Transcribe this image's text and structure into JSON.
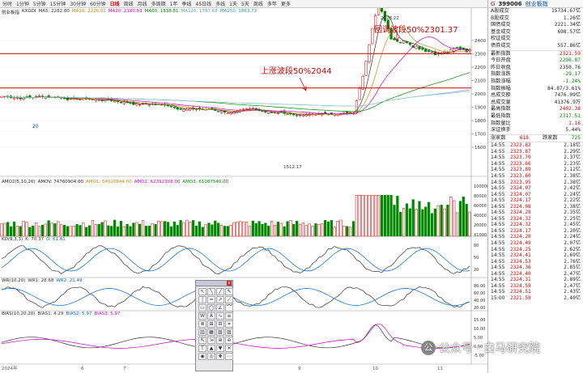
{
  "tabs": [
    "分时",
    "1分钟",
    "5分钟",
    "15分钟",
    "30分钟",
    "60分钟",
    "日线",
    "周线",
    "月线",
    "多周期",
    "1年",
    "季线",
    "45日线",
    "多线",
    "1天",
    "5天",
    "周线",
    "多年",
    "更多"
  ],
  "active_tab": "日线",
  "main_legend": {
    "name": "创业板指",
    "prefix": "KXGDI",
    "ma5": "MA5: 2282.80",
    "ma10": "MA10: 2226.01",
    "ma20": "MA20: 2180.83",
    "ma60": "MA60: 1838.81",
    "ma120": "MA120: 1787.68",
    "ma250": "MA250: 1863.73"
  },
  "annotations": {
    "pullback": "回调波段50%2301.37",
    "rise": "上涨波段50%2044",
    "high": "2578.22",
    "low": "1512.17",
    "marker_20": "20"
  },
  "price_axis": [
    "2400",
    "2300",
    "2200",
    "2100",
    "2000",
    "1900",
    "1800",
    "1700",
    "1600"
  ],
  "date_labels": [
    "2024年",
    "6",
    "7",
    "8",
    "9",
    "10",
    "11"
  ],
  "vol_legend": {
    "name": "AMO2(5,10,20)",
    "amov": "AMOV: 74760904.00",
    "amo1": "AMO1: 64520844.00",
    "amo2": "AMO2: 62392308.00",
    "amo3": "AMO3: 61087540.00"
  },
  "vol_axis": [
    "100000",
    "80000",
    "60000",
    "40000",
    "20000",
    "X1000"
  ],
  "kd_legend": {
    "name": "KD(9,3,3)",
    "k": "K: 70.37",
    "d": "D: 61.81"
  },
  "kd_axis": [
    "80",
    "50",
    "20"
  ],
  "wr_legend": {
    "name": "WR(10,20)",
    "wr1": "WR1: 28.68",
    "wr2": "WR2: 21.49"
  },
  "wr_axis": [
    "80.00",
    "60.00",
    "40.00",
    "20.00"
  ],
  "bias_legend": {
    "name": "BIAS(10,20,20)",
    "b1": "BIAS1: 4.29",
    "b2": "BIAS2: 5.97",
    "b3": "BIAS3: 5.97"
  },
  "bias_axis": [
    "15.00",
    "10.00",
    "5.00",
    "0.00",
    "-5.00"
  ],
  "tools": [
    "↖",
    "╲",
    "╱",
    "✎",
    "│",
    "━",
    "↗",
    "⟋",
    "▭",
    "◯",
    "∠",
    "⌒",
    "W",
    "A",
    "∿",
    "≡",
    "≣",
    "⊞",
    "⊟",
    "⌗",
    "▥",
    "▦",
    "▧",
    "▨",
    "⇱",
    "⇲",
    "⊕",
    "⊖",
    "T",
    "▲",
    "▼",
    "✕",
    "◉",
    "◎",
    "✚",
    "⋯"
  ],
  "toolbox_close": "x",
  "instrument": {
    "code": "399006",
    "name": "创业板指",
    "flag": "G"
  },
  "stats_top": [
    {
      "label": "A股成交",
      "value": "15734.67亿",
      "color": "#222"
    },
    {
      "label": "B股成交",
      "value": "1.26亿",
      "color": "#222"
    },
    {
      "label": "国债成交",
      "value": "2221.34亿",
      "color": "#222"
    },
    {
      "label": "基金成交",
      "value": "698.57亿",
      "color": "#222"
    },
    {
      "label": "权证成交",
      "value": "",
      "color": "#222"
    },
    {
      "label": "债券成交",
      "value": "557.86亿",
      "color": "#222"
    }
  ],
  "stats_mid": [
    {
      "label": "最新指数",
      "value": "2321.59",
      "color": "#d00000"
    },
    {
      "label": "今日开盘",
      "value": "2296.87",
      "color": "#008800"
    },
    {
      "label": "昨日收盘",
      "value": "2350.76",
      "color": "#222"
    },
    {
      "label": "指数涨跌",
      "value": "-29.17",
      "color": "#008800"
    },
    {
      "label": "指数涨幅",
      "value": "-1.24%",
      "color": "#008800"
    },
    {
      "label": "指数振幅",
      "value": "84.87/3.61%",
      "color": "#222"
    },
    {
      "label": "总成交额",
      "value": "7476.09亿",
      "color": "#222"
    },
    {
      "label": "总成交量",
      "value": "41376.9万",
      "color": "#222"
    },
    {
      "label": "最高指数",
      "value": "2402.38",
      "color": "#d00000"
    },
    {
      "label": "最低指数",
      "value": "2317.51",
      "color": "#008800"
    },
    {
      "label": "指数量比",
      "value": "1.16",
      "color": "#d00000"
    },
    {
      "label": "深证换手",
      "value": "5.44%",
      "color": "#222"
    }
  ],
  "updown": {
    "up_label": "涨家数",
    "up": "618",
    "down_label": "跌家数",
    "down": "725"
  },
  "ticks": [
    {
      "t": "14:55",
      "p": "2323.82",
      "q": "2.18亿"
    },
    {
      "t": "14:55",
      "p": "2323.87",
      "q": "2.29亿"
    },
    {
      "t": "14:55",
      "p": "2323.70",
      "q": "2.37亿"
    },
    {
      "t": "14:55",
      "p": "2323.66",
      "q": "2.23亿"
    },
    {
      "t": "14:55",
      "p": "2323.89",
      "q": "2.12亿"
    },
    {
      "t": "14:55",
      "p": "2323.60",
      "q": "2.38亿"
    },
    {
      "t": "14:55",
      "p": "2323.95",
      "q": "2.38亿"
    },
    {
      "t": "14:55",
      "p": "2324.07",
      "q": "2.42亿"
    },
    {
      "t": "14:55",
      "p": "2324.07",
      "q": "2.24亿"
    },
    {
      "t": "14:55",
      "p": "2324.17",
      "q": "2.22亿"
    },
    {
      "t": "14:55",
      "p": "2324.08",
      "q": "2.38亿"
    },
    {
      "t": "14:55",
      "p": "2324.29",
      "q": "2.35亿"
    },
    {
      "t": "14:55",
      "p": "2324.32",
      "q": "2.25亿"
    },
    {
      "t": "14:55",
      "p": "2324.32",
      "q": "2.45亿"
    },
    {
      "t": "14:55",
      "p": "2324.17",
      "q": "2.20亿"
    },
    {
      "t": "14:55",
      "p": "2324.20",
      "q": "2.24亿"
    },
    {
      "t": "14:55",
      "p": "2324.49",
      "q": "2.07亿"
    },
    {
      "t": "14:55",
      "p": "2324.25",
      "q": "2.62亿"
    },
    {
      "t": "14:55",
      "p": "2324.41",
      "q": "2.69亿"
    },
    {
      "t": "14:55",
      "p": "2324.53",
      "q": "2.76亿"
    },
    {
      "t": "14:55",
      "p": "2324.36",
      "q": "2.85亿"
    },
    {
      "t": "14:55",
      "p": "2324.40",
      "q": "2.47亿"
    },
    {
      "t": "14:55",
      "p": "2324.31",
      "q": "2.89亿"
    },
    {
      "t": "14:55",
      "p": "2324.59",
      "q": "2.47亿"
    },
    {
      "t": "14:55",
      "p": "2324.51",
      "q": "2.43亿"
    },
    {
      "t": "15:00",
      "p": "2321.59",
      "q": "2.40亿"
    }
  ],
  "watermark": {
    "icon": "公",
    "text": "公众号 · 白马研究院"
  },
  "colors": {
    "up": "#d00000",
    "down": "#008800",
    "ma5": "#333333",
    "ma10": "#cc8800",
    "ma20": "#cc00cc",
    "ma60": "#008800",
    "ma120": "#6699cc",
    "ma250": "#99cccc",
    "level": "#cc0000"
  }
}
